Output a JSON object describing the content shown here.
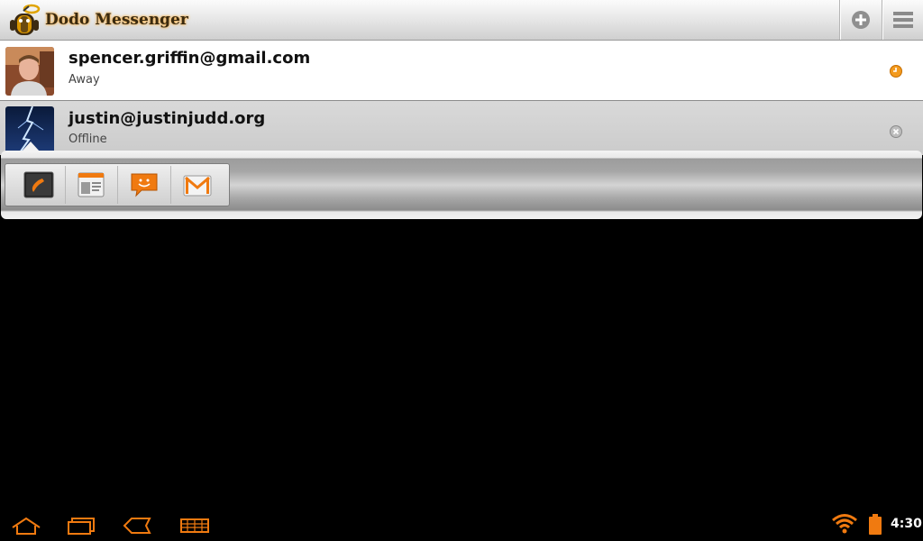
{
  "app": {
    "title": "Dodo Messenger"
  },
  "toolbar": {
    "add_icon": "add-contact-icon",
    "menu_icon": "overflow-menu-icon"
  },
  "contacts": [
    {
      "email": "spencer.griffin@gmail.com",
      "status": "Away",
      "presence_icon": "away-clock-icon",
      "presence_color": "#f39a1e"
    },
    {
      "email": "justin@justinjudd.org",
      "status": "Offline",
      "presence_icon": "offline-x-icon",
      "presence_color": "#9e9e9e"
    }
  ],
  "quick_actions": [
    {
      "name": "call",
      "icon": "phone-icon"
    },
    {
      "name": "contact-details",
      "icon": "address-book-icon"
    },
    {
      "name": "chat",
      "icon": "chat-bubble-icon"
    },
    {
      "name": "email",
      "icon": "gmail-icon"
    }
  ],
  "system_bar": {
    "nav": [
      "home-icon",
      "recent-apps-icon",
      "back-icon",
      "keyboard-icon"
    ],
    "clock": "4:30",
    "accent": "#f07a10"
  }
}
